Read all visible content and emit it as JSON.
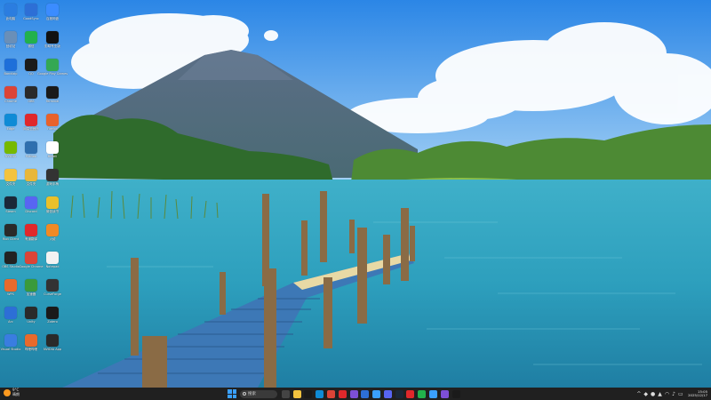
{
  "wallpaper": {
    "description_icon": "lake-dock-volcano-wallpaper"
  },
  "desktop": {
    "icons": [
      {
        "label": "此电脑",
        "icon": "this-pc-icon",
        "color": "#2b7de0"
      },
      {
        "label": "GoodSync",
        "icon": "goodsync-icon",
        "color": "#2d6fd6"
      },
      {
        "label": "百度网盘",
        "icon": "baidu-netdisk-icon",
        "color": "#3b8cff"
      },
      {
        "label": "回收站",
        "icon": "recycle-bin-icon",
        "color": "#6a8fb8"
      },
      {
        "label": "微信",
        "icon": "wechat-icon",
        "color": "#22b14c"
      },
      {
        "label": "剪映专业版",
        "icon": "capcut-icon",
        "color": "#111111"
      },
      {
        "label": "Bandizip",
        "icon": "bandizip-icon",
        "color": "#1e6fd9"
      },
      {
        "label": "QQ",
        "icon": "qq-icon",
        "color": "#1b1b1b"
      },
      {
        "label": "Google Play Games",
        "icon": "play-games-icon",
        "color": "#34a853"
      },
      {
        "label": "Chrome",
        "icon": "chrome-icon",
        "color": "#db4437"
      },
      {
        "label": "OBS",
        "icon": "obs-icon",
        "color": "#2a2a2a"
      },
      {
        "label": "Terminal",
        "icon": "terminal-icon",
        "color": "#1a1a1a"
      },
      {
        "label": "Edge",
        "icon": "edge-icon",
        "color": "#0f8bd6"
      },
      {
        "label": "网易云音乐",
        "icon": "netease-music-icon",
        "color": "#e0282b"
      },
      {
        "label": "Firefox",
        "icon": "firefox-icon",
        "color": "#e8622b"
      },
      {
        "label": "NVIDIA",
        "icon": "nvidia-icon",
        "color": "#76b900"
      },
      {
        "label": "Python",
        "icon": "python-icon",
        "color": "#2f6fae"
      },
      {
        "label": "Bilibili",
        "icon": "bilibili-icon",
        "color": "#ffffff"
      },
      {
        "label": "文件夹",
        "icon": "folder-icon",
        "color": "#f3c33f"
      },
      {
        "label": "文件夹",
        "icon": "folder-icon",
        "color": "#e8b73a"
      },
      {
        "label": "游戏手柄",
        "icon": "gamepad-icon",
        "color": "#333333"
      },
      {
        "label": "Steam",
        "icon": "steam-icon",
        "color": "#1b2838"
      },
      {
        "label": "Discord",
        "icon": "discord-icon",
        "color": "#5865f2"
      },
      {
        "label": "微信读书",
        "icon": "oo-icon",
        "color": "#e9c02a"
      },
      {
        "label": "Riot Client",
        "icon": "riot-icon",
        "color": "#2a2a2a"
      },
      {
        "label": "有道翻译",
        "icon": "youdao-icon",
        "color": "#e0282b"
      },
      {
        "label": "火绒",
        "icon": "flame-icon",
        "color": "#f08a24"
      },
      {
        "label": "OBS Studio",
        "icon": "obs-studio-icon",
        "color": "#222222"
      },
      {
        "label": "Google Chrome",
        "icon": "chrome-icon-2",
        "color": "#db4437"
      },
      {
        "label": "Notepad",
        "icon": "notepad-icon",
        "color": "#f2f2f2"
      },
      {
        "label": "WPS",
        "icon": "wps-icon",
        "color": "#e86a2c"
      },
      {
        "label": "加速器",
        "icon": "accelerator-icon",
        "color": "#3a9a3a"
      },
      {
        "label": "CurseForge",
        "icon": "curseforge-icon",
        "color": "#333333"
      },
      {
        "label": "Arc",
        "icon": "arc-icon",
        "color": "#2d6fd6"
      },
      {
        "label": "Unity",
        "icon": "unity-icon",
        "color": "#2a2a2a"
      },
      {
        "label": "Zotero",
        "icon": "zotero-icon",
        "color": "#1a1a1a"
      },
      {
        "label": "Visual Studio",
        "icon": "visual-studio-icon",
        "color": "#3a7de0"
      },
      {
        "label": "哔哩哔哩",
        "icon": "orange-app-icon",
        "color": "#e86a2c"
      },
      {
        "label": "NVIDIA App",
        "icon": "nvidia-app-icon",
        "color": "#2a2a2a"
      }
    ]
  },
  "taskbar": {
    "weather_temp": "9°C",
    "weather_desc": "晴朗",
    "search_placeholder": "搜索",
    "apps": [
      {
        "name": "task-view-icon",
        "color": "#444444"
      },
      {
        "name": "file-explorer-icon",
        "color": "#f3c33f"
      },
      {
        "name": "terminal-icon",
        "color": "#1a1a1a"
      },
      {
        "name": "edge-icon",
        "color": "#0f8bd6"
      },
      {
        "name": "chrome-icon",
        "color": "#db4437"
      },
      {
        "name": "netease-music-icon",
        "color": "#e0282b"
      },
      {
        "name": "purple-app-icon",
        "color": "#7d4fd6"
      },
      {
        "name": "blue-app-icon",
        "color": "#2d6fd6"
      },
      {
        "name": "check-icon",
        "color": "#3aa0ff"
      },
      {
        "name": "discord-icon",
        "color": "#5865f2"
      },
      {
        "name": "steam-icon",
        "color": "#1b2838"
      },
      {
        "name": "youdao-icon",
        "color": "#e0282b"
      },
      {
        "name": "wechat-icon",
        "color": "#22b14c"
      },
      {
        "name": "store-icon",
        "color": "#3aa0ff"
      },
      {
        "name": "visual-studio-icon",
        "color": "#7d4fd6"
      },
      {
        "name": "zotero-icon",
        "color": "#1a1a1a"
      }
    ],
    "tray_chevron": "^",
    "clock_time": "15:05",
    "clock_date": "2025/12/17"
  }
}
